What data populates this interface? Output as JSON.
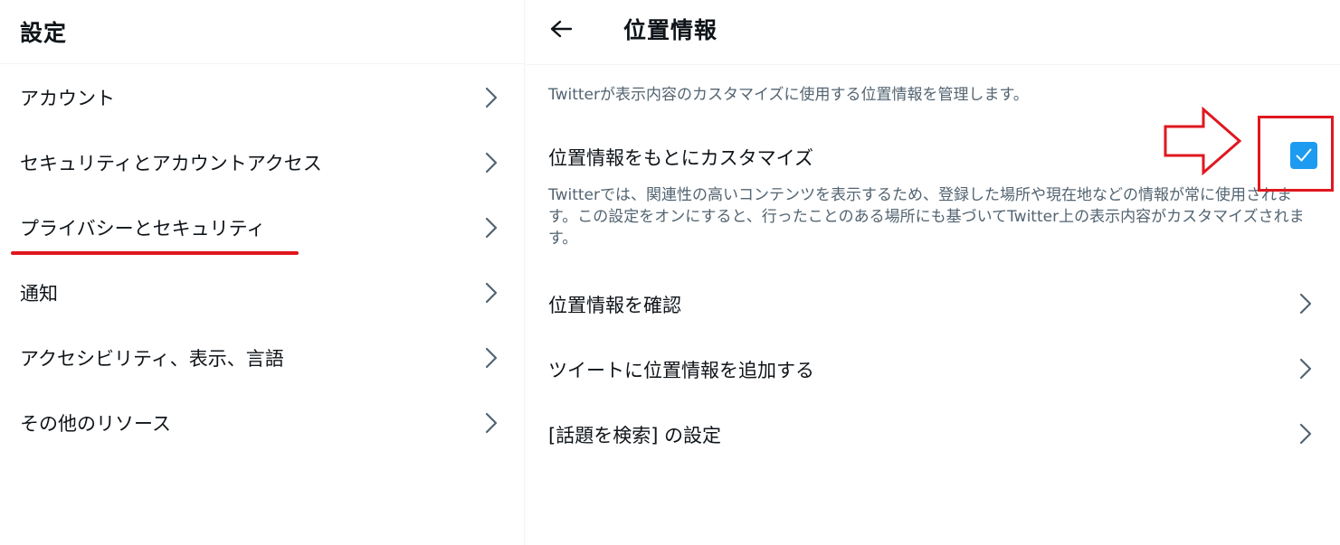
{
  "left": {
    "title": "設定",
    "items": [
      {
        "label": "アカウント"
      },
      {
        "label": "セキュリティとアカウントアクセス"
      },
      {
        "label": "プライバシーとセキュリティ"
      },
      {
        "label": "通知"
      },
      {
        "label": "アクセシビリティ、表示、言語"
      },
      {
        "label": "その他のリソース"
      }
    ]
  },
  "right": {
    "title": "位置情報",
    "intro": "Twitterが表示内容のカスタマイズに使用する位置情報を管理します。",
    "setting": {
      "label": "位置情報をもとにカスタマイズ",
      "checked": true,
      "description": "Twitterでは、関連性の高いコンテンツを表示するため、登録した場所や現在地などの情報が常に使用されます。この設定をオンにすると、行ったことのある場所にも基づいてTwitter上の表示内容がカスタマイズされます。"
    },
    "items": [
      {
        "label": "位置情報を確認"
      },
      {
        "label": "ツイートに位置情報を追加する"
      },
      {
        "label": "[話題を検索] の設定"
      }
    ]
  },
  "colors": {
    "accent": "#1d9bf0",
    "annotation": "#e0171f",
    "text_primary": "#0f1419",
    "text_secondary": "#536471",
    "divider": "#eff3f4"
  },
  "icons": {
    "back": "arrow-left-icon",
    "chevron": "chevron-right-icon",
    "check": "check-icon",
    "annotation_arrow": "arrow-right-icon"
  }
}
